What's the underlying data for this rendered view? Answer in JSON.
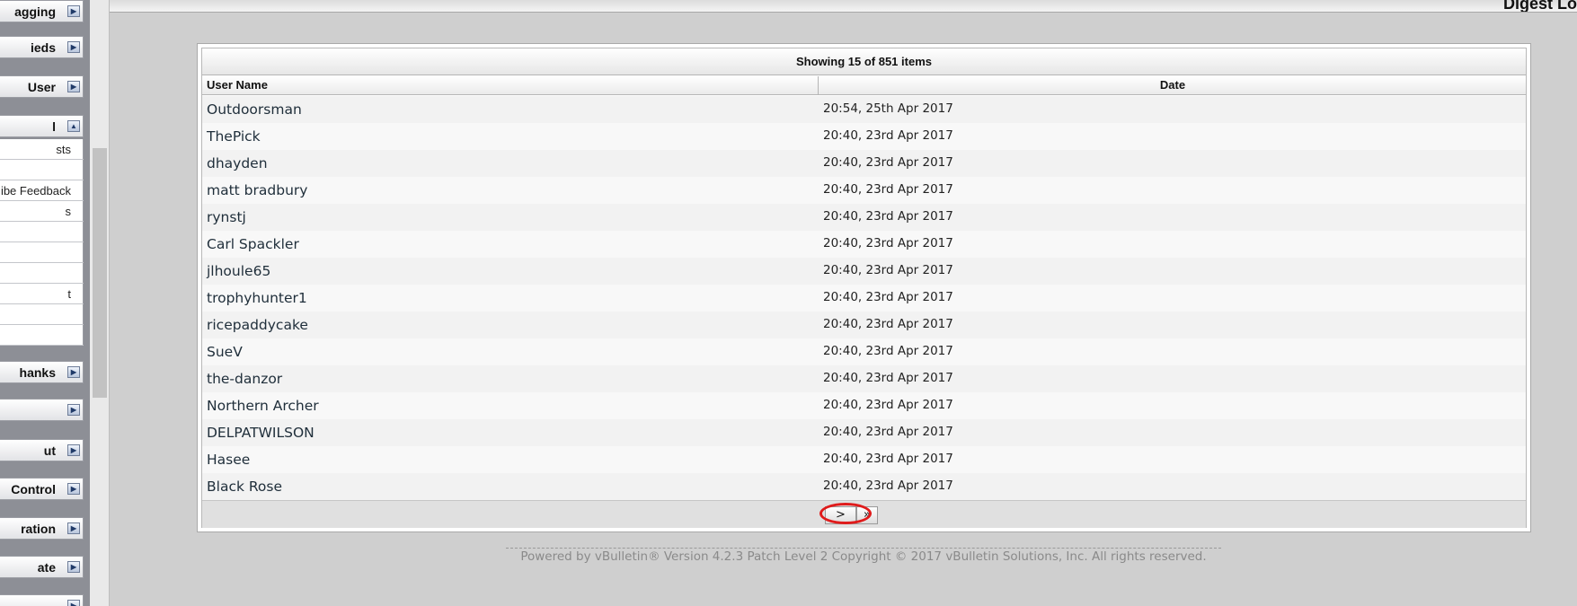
{
  "page": {
    "heading": "Digest Lo",
    "footer": "Powered by vBulletin® Version 4.2.3 Patch Level 2 Copyright © 2017 vBulletin Solutions, Inc. All rights reserved."
  },
  "sidebar": {
    "groups_top": [
      {
        "label": "agging",
        "arrow": "▶"
      },
      {
        "label": "ieds",
        "arrow": "▶"
      },
      {
        "label": "User",
        "arrow": "▶"
      }
    ],
    "expanded_group": {
      "label": "l",
      "arrow": "▲"
    },
    "expanded_items": [
      "sts",
      "",
      "ibe Feedback",
      "s",
      "",
      "",
      "",
      "t",
      "",
      ""
    ],
    "groups_bottom": [
      {
        "label": "hanks",
        "arrow": "▶"
      },
      {
        "label": "",
        "arrow": "▶"
      },
      {
        "label": "ut",
        "arrow": "▶"
      },
      {
        "label": "Control",
        "arrow": "▶"
      },
      {
        "label": "ration",
        "arrow": "▶"
      },
      {
        "label": "ate",
        "arrow": "▶"
      },
      {
        "label": "",
        "arrow": "▶"
      }
    ]
  },
  "table": {
    "title": "Showing 15 of 851 items",
    "columns": {
      "user": "User Name",
      "date": "Date"
    },
    "rows": [
      {
        "user": "Outdoorsman",
        "date": "20:54, 25th Apr 2017"
      },
      {
        "user": "ThePick",
        "date": "20:40, 23rd Apr 2017"
      },
      {
        "user": "dhayden",
        "date": "20:40, 23rd Apr 2017"
      },
      {
        "user": "matt bradbury",
        "date": "20:40, 23rd Apr 2017"
      },
      {
        "user": "rynstj",
        "date": "20:40, 23rd Apr 2017"
      },
      {
        "user": "Carl Spackler",
        "date": "20:40, 23rd Apr 2017"
      },
      {
        "user": "jlhoule65",
        "date": "20:40, 23rd Apr 2017"
      },
      {
        "user": "trophyhunter1",
        "date": "20:40, 23rd Apr 2017"
      },
      {
        "user": "ricepaddycake",
        "date": "20:40, 23rd Apr 2017"
      },
      {
        "user": "SueV",
        "date": "20:40, 23rd Apr 2017"
      },
      {
        "user": "the-danzor",
        "date": "20:40, 23rd Apr 2017"
      },
      {
        "user": "Northern Archer",
        "date": "20:40, 23rd Apr 2017"
      },
      {
        "user": "DELPATWILSON",
        "date": "20:40, 23rd Apr 2017"
      },
      {
        "user": "Hasee",
        "date": "20:40, 23rd Apr 2017"
      },
      {
        "user": "Black Rose",
        "date": "20:40, 23rd Apr 2017"
      }
    ],
    "pager": {
      "next": ">",
      "last": "»"
    }
  },
  "colors": {
    "highlight": "#e01b1b",
    "sidebar_bg": "#8d8f96",
    "page_bg": "#cfcfcf"
  }
}
